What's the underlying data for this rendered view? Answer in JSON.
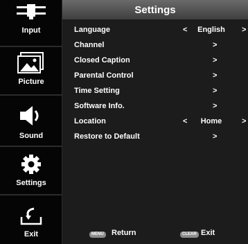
{
  "sidebar": {
    "items": [
      {
        "label": "Input",
        "icon": "input-connector-icon"
      },
      {
        "label": "Picture",
        "icon": "picture-icon"
      },
      {
        "label": "Sound",
        "icon": "speaker-icon"
      },
      {
        "label": "Settings",
        "icon": "gear-icon"
      },
      {
        "label": "Exit",
        "icon": "exit-arrow-icon"
      }
    ]
  },
  "header": {
    "title": "Settings"
  },
  "menu": {
    "items": [
      {
        "label": "Language",
        "left_arrow": "<",
        "value": "English",
        "right_arrow": ">"
      },
      {
        "label": "Channel",
        "right_arrow": ">"
      },
      {
        "label": "Closed Caption",
        "right_arrow": ">"
      },
      {
        "label": "Parental Control",
        "right_arrow": ">"
      },
      {
        "label": "Time Setting",
        "right_arrow": ">"
      },
      {
        "label": "Software Info.",
        "right_arrow": ">"
      },
      {
        "label": "Location",
        "left_arrow": "<",
        "value": "Home",
        "right_arrow": ">"
      },
      {
        "label": "Restore to Default",
        "right_arrow": ">"
      }
    ]
  },
  "footer": {
    "return_key": "MENU",
    "return_label": "Return",
    "exit_key": "CLEAR",
    "exit_label": "Exit"
  },
  "colors": {
    "sidebar_bg": "#050505",
    "main_bg": "#1c1c1c",
    "header_bg": "#555555",
    "key_bg": "#8c8c8c"
  }
}
